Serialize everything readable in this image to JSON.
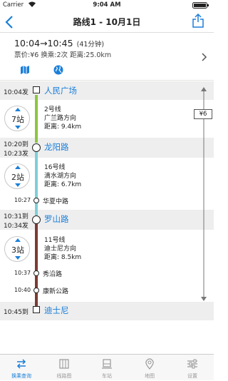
{
  "status_bar": {
    "carrier": "Carrier",
    "time": "9:04 AM"
  },
  "nav": {
    "title": "路线1 - 10月1日"
  },
  "summary": {
    "time_range": "10:04→10:45",
    "duration": "(41分钟)",
    "detail": "票价:¥6 换乘:2次 距离:25.0km"
  },
  "fare_badge": "¥6",
  "stations": [
    {
      "time": "10:04发",
      "name": "人民广场"
    },
    {
      "time_arrive": "10:20到",
      "time_depart": "10:23发",
      "name": "龙阳路"
    },
    {
      "time_arrive": "10:31到",
      "time_depart": "10:34发",
      "name": "罗山路"
    },
    {
      "time": "10:45到",
      "name": "迪士尼"
    }
  ],
  "segments": [
    {
      "stops": "7站",
      "line": "2号线",
      "direction": "广兰路方向",
      "distance": "距离: 9.4km",
      "color": "#8cc63f"
    },
    {
      "stops": "2站",
      "line": "16号线",
      "direction": "滴水湖方向",
      "distance": "距离: 6.7km",
      "color": "#7fcfd6"
    },
    {
      "stops": "3站",
      "line": "11号线",
      "direction": "迪士尼方向",
      "distance": "距离: 8.5km",
      "color": "#7c3b33"
    }
  ],
  "intermediate": [
    {
      "time": "10:27",
      "name": "华夏中路"
    },
    {
      "time": "10:37",
      "name": "秀沿路"
    },
    {
      "time": "10:40",
      "name": "康新公路"
    }
  ],
  "tabs": [
    {
      "label": "换乘查询",
      "icon": "transfer-icon",
      "active": true
    },
    {
      "label": "线路图",
      "icon": "map-book-icon",
      "active": false
    },
    {
      "label": "车站",
      "icon": "station-icon",
      "active": false
    },
    {
      "label": "地图",
      "icon": "location-pin-icon",
      "active": false
    },
    {
      "label": "设置",
      "icon": "settings-sliders-icon",
      "active": false
    }
  ],
  "colors": {
    "accent": "#1b7fd8",
    "band": "#eeeeef"
  }
}
